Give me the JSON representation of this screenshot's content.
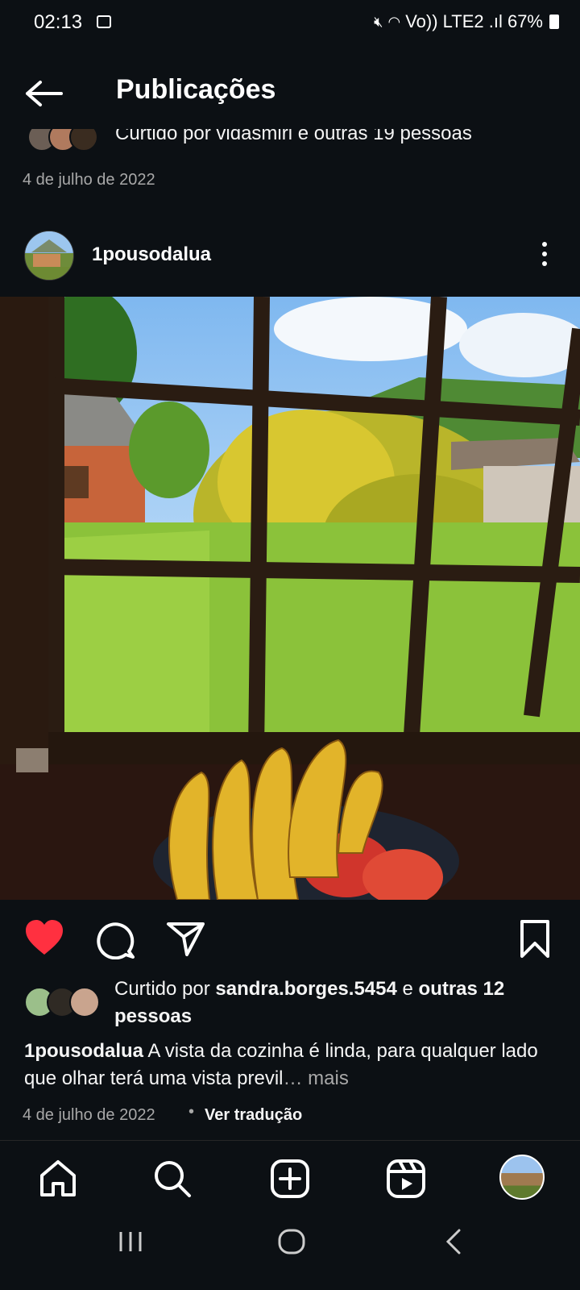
{
  "status_bar": {
    "time": "02:13",
    "right_text": "Vo)) LTE2 .ıl 67%"
  },
  "header": {
    "title": "Publicações"
  },
  "previous_post": {
    "liked_by_text": "Curtido por vidasmiri e outras 19 pessoas",
    "date": "4 de julho de 2022"
  },
  "post": {
    "username": "1pousodalua",
    "liked_by_prefix": "Curtido por ",
    "liked_by_user": "sandra.borges.5454",
    "liked_by_mid": " e ",
    "liked_by_others": "outras 12 pessoas",
    "caption_user": "1pousodalua",
    "caption_text": " A vista da cozinha é linda, para qualquer lado que olhar terá uma vista previl",
    "caption_more": "… mais",
    "date": "4 de julho de 2022",
    "separator": "•",
    "translate_label": "Ver tradução"
  },
  "icons": {
    "like": "heart-filled-icon",
    "comment": "comment-icon",
    "share": "send-icon",
    "save": "bookmark-icon"
  },
  "colors": {
    "background": "#0c1014",
    "like_red": "#ff3040",
    "muted_text": "#a8a8a8"
  },
  "bottom_nav": [
    "home-icon",
    "search-icon",
    "create-icon",
    "reels-icon",
    "profile-avatar"
  ],
  "system_nav": [
    "recents-icon",
    "home-button-icon",
    "back-icon"
  ]
}
